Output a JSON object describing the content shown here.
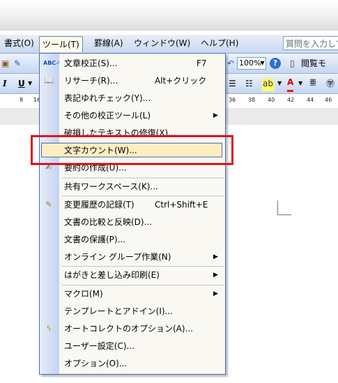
{
  "menubar": {
    "items": [
      {
        "label": "書式(O)",
        "active": false
      },
      {
        "label": "ツール(T)",
        "active": true
      },
      {
        "label": "罫線(A)",
        "active": false
      },
      {
        "label": "ウィンドウ(W)",
        "active": false
      },
      {
        "label": "ヘルプ(H)",
        "active": false
      }
    ],
    "help_search_placeholder": "質問を入力して"
  },
  "toolbar1": {
    "zoom_value": "100%",
    "read_mode_label": "閲覧モ"
  },
  "toolbar2": {
    "italic": "I",
    "underline": "U"
  },
  "ruler": {
    "left_numbers": [
      "8",
      "16"
    ],
    "right_numbers": [
      "36",
      "38",
      "40",
      "42",
      "44",
      "46"
    ]
  },
  "tools_menu": {
    "items": [
      {
        "label": "文章校正(S)...",
        "shortcut": "F7",
        "icon": "spelling-abc-check-icon"
      },
      {
        "label": "リサーチ(R)...",
        "shortcut": "Alt+クリック",
        "icon": "research-book-icon"
      },
      {
        "label": "表記ゆれチェック(Y)...",
        "shortcut": "",
        "icon": ""
      },
      {
        "label": "その他の校正ツール(L)",
        "shortcut": "",
        "icon": "",
        "submenu": true
      },
      {
        "label": "破損したテキストの修復(X)...",
        "shortcut": "",
        "icon": ""
      },
      {
        "label": "文字カウント(W)...",
        "shortcut": "",
        "icon": "",
        "highlighted": true
      },
      {
        "label": "要約の作成(U)...",
        "shortcut": "",
        "icon": "autosummarize-icon"
      },
      {
        "label": "共有ワークスペース(K)...",
        "shortcut": "",
        "icon": ""
      },
      {
        "label": "変更履歴の記録(T)",
        "shortcut": "Ctrl+Shift+E",
        "icon": "track-changes-icon"
      },
      {
        "label": "文書の比較と反映(D)...",
        "shortcut": "",
        "icon": ""
      },
      {
        "label": "文書の保護(P)...",
        "shortcut": "",
        "icon": ""
      },
      {
        "label": "オンライン グループ作業(N)",
        "shortcut": "",
        "icon": "",
        "submenu": true
      },
      {
        "label": "はがきと差し込み印刷(E)",
        "shortcut": "",
        "icon": "",
        "submenu": true
      },
      {
        "label": "マクロ(M)",
        "shortcut": "",
        "icon": "",
        "submenu": true
      },
      {
        "label": "テンプレートとアドイン(I)...",
        "shortcut": "",
        "icon": ""
      },
      {
        "label": "オートコレクトのオプション(A)...",
        "shortcut": "",
        "icon": "autocorrect-lightning-icon"
      },
      {
        "label": "ユーザー設定(C)...",
        "shortcut": "",
        "icon": ""
      },
      {
        "label": "オプション(O)...",
        "shortcut": "",
        "icon": ""
      }
    ]
  },
  "colors": {
    "highlight_fill": "#ffeec2",
    "menu_border": "#4a6bbd",
    "annotation_red": "#e0121d"
  }
}
